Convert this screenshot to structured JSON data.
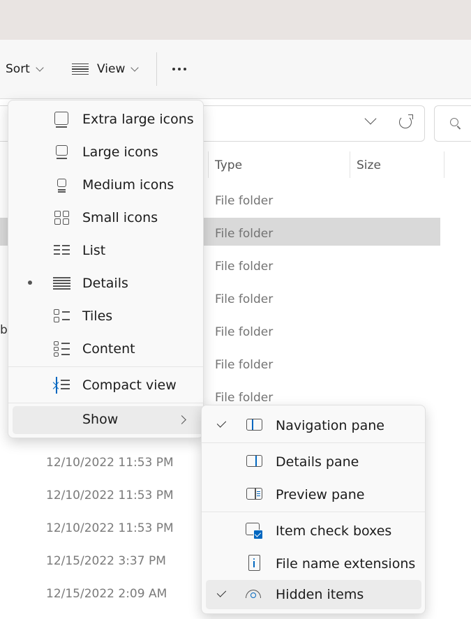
{
  "toolbar": {
    "sort_label": "Sort",
    "view_label": "View",
    "more_label": "More options"
  },
  "columns": {
    "type": "Type",
    "size": "Size"
  },
  "rows": [
    {
      "type": "File folder"
    },
    {
      "type": "File folder"
    },
    {
      "type": "File folder"
    },
    {
      "type": "File folder"
    },
    {
      "type": "File folder"
    },
    {
      "type": "File folder"
    },
    {
      "type": "File folder"
    }
  ],
  "stray_text": "b",
  "dates": [
    "12/10/2022 11:53 PM",
    "12/10/2022 11:53 PM",
    "12/10/2022 11:53 PM",
    "12/15/2022 3:37 PM",
    "12/15/2022 2:09 AM"
  ],
  "view_menu": {
    "items": [
      {
        "label": "Extra large icons",
        "icon": "extra-large-icons-icon"
      },
      {
        "label": "Large icons",
        "icon": "large-icons-icon"
      },
      {
        "label": "Medium icons",
        "icon": "medium-icons-icon"
      },
      {
        "label": "Small icons",
        "icon": "small-icons-icon"
      },
      {
        "label": "List",
        "icon": "list-icon"
      },
      {
        "label": "Details",
        "icon": "details-icon",
        "selected": true
      },
      {
        "label": "Tiles",
        "icon": "tiles-icon"
      },
      {
        "label": "Content",
        "icon": "content-icon"
      }
    ],
    "compact_view": "Compact view",
    "show": "Show"
  },
  "show_menu": {
    "items": [
      {
        "label": "Navigation pane",
        "icon": "navigation-pane-icon",
        "checked": true
      },
      {
        "label": "Details pane",
        "icon": "details-pane-icon",
        "checked": false
      },
      {
        "label": "Preview pane",
        "icon": "preview-pane-icon",
        "checked": false
      },
      {
        "label": "Item check boxes",
        "icon": "item-check-boxes-icon",
        "checked": false
      },
      {
        "label": "File name extensions",
        "icon": "file-name-extensions-icon",
        "checked": false
      },
      {
        "label": "Hidden items",
        "icon": "hidden-items-icon",
        "checked": true
      }
    ]
  },
  "colors": {
    "accent": "#0067c0",
    "selection": "#d9d9d9",
    "menu_bg": "#f9f9f9"
  }
}
